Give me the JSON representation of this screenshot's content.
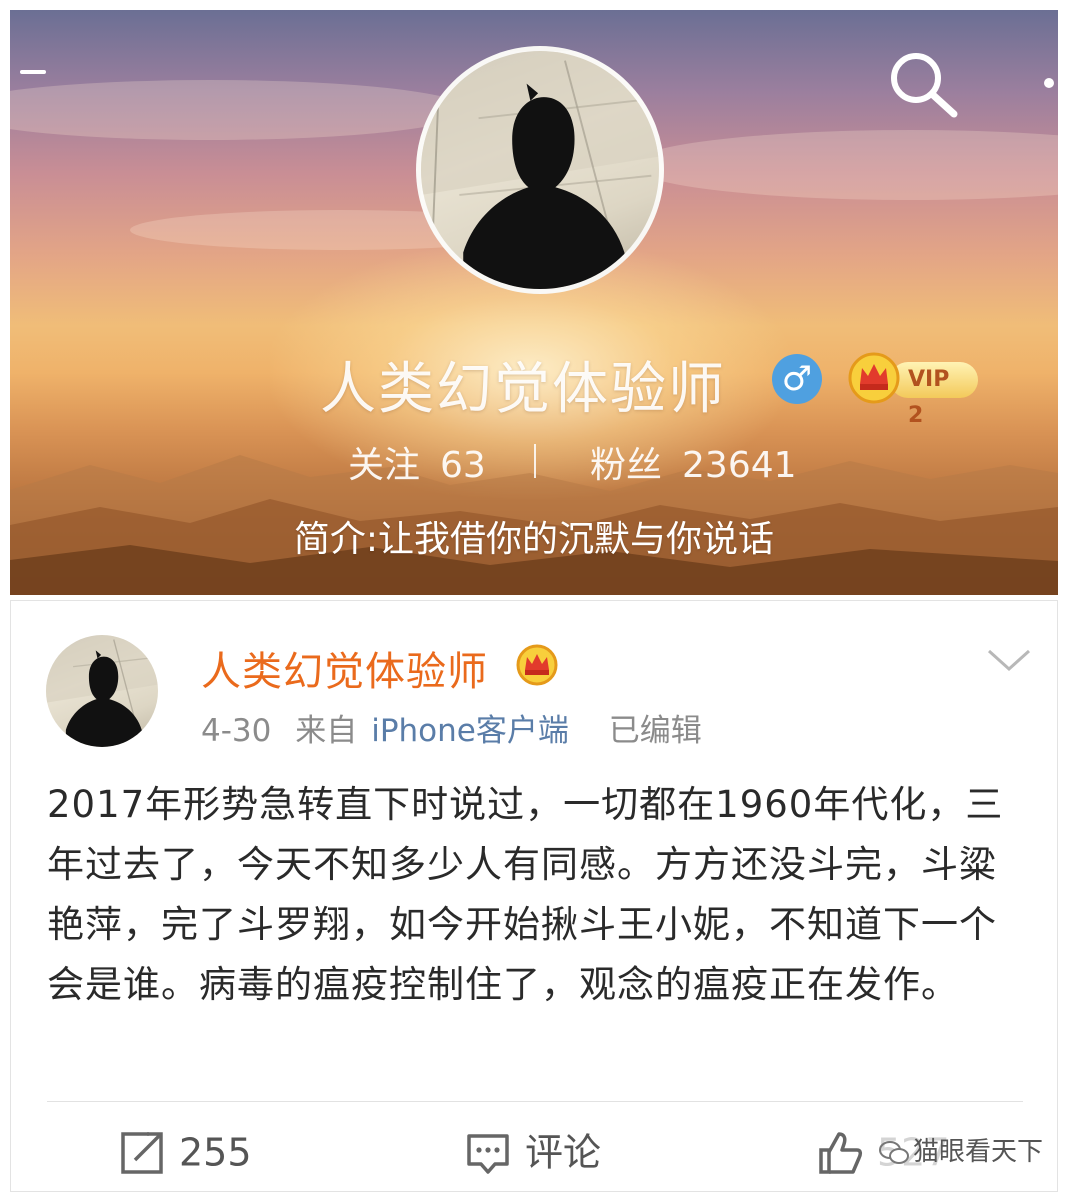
{
  "profile": {
    "name": "人类幻觉体验师",
    "gender_symbol": "♂",
    "vip_label": "VIP 2",
    "stats": {
      "following_label": "关注",
      "following_count": "63",
      "divider": "|",
      "followers_label": "粉丝",
      "followers_count": "23641"
    },
    "bio": "简介:让我借你的沉默与你说话",
    "icons": [
      "menu-icon",
      "search-icon",
      "more-icon",
      "male-icon",
      "vip-crown-icon"
    ]
  },
  "post": {
    "author": "人类幻觉体验师",
    "date": "4-30",
    "source_prefix": "来自",
    "source_client": "iPhone客户端",
    "edited": "已编辑",
    "body": "2017年形势急转直下时说过，一切都在1960年代化，三年过去了，今天不知多少人有同感。方方还没斗完，斗粱艳萍，完了斗罗翔，如今开始揪斗王小妮，不知道下一个会是谁。病毒的瘟疫控制住了，观念的瘟疫正在发作。",
    "actions": {
      "repost_count": "255",
      "comment_label": "评论",
      "like_count": "527"
    },
    "watermark": "猫眼看天下"
  },
  "colors": {
    "author_orange": "#ea6a1c",
    "link_blue": "#5a7da8",
    "meta_gray": "#8b8b8b",
    "male_blue": "#4fa0e0"
  }
}
